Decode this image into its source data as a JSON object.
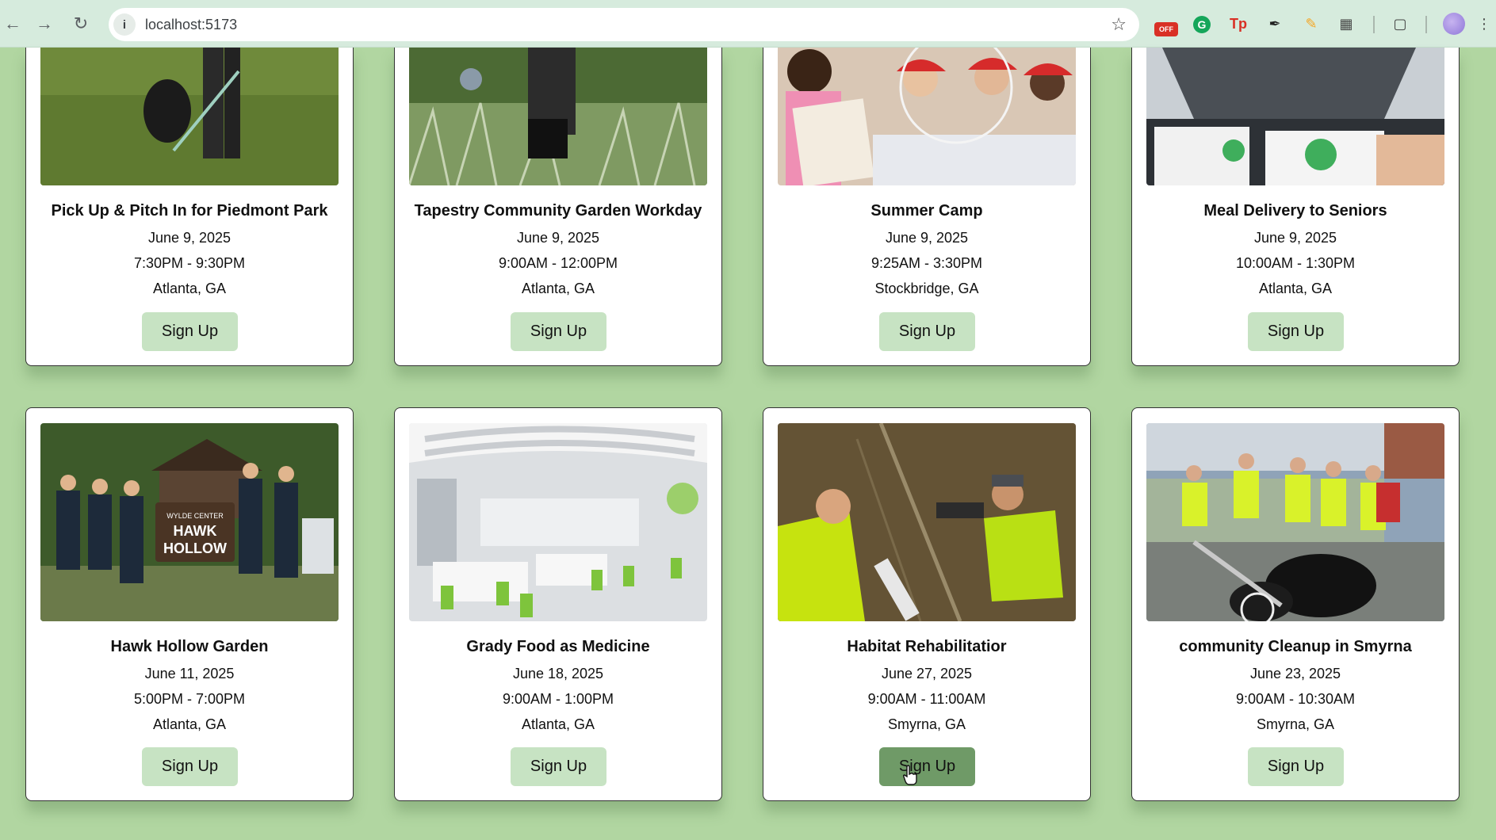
{
  "browser": {
    "url": "localhost:5173",
    "extensions": {
      "off_badge": "OFF",
      "grammarly": "G",
      "tp": "Tp"
    }
  },
  "cards": [
    {
      "title": "Pick Up & Pitch In for Piedmont Park",
      "date": "June 9, 2025",
      "time": "7:30PM - 9:30PM",
      "location": "Atlanta, GA",
      "button": "Sign Up"
    },
    {
      "title": "Tapestry Community Garden Workday",
      "date": "June 9, 2025",
      "time": "9:00AM - 12:00PM",
      "location": "Atlanta, GA",
      "button": "Sign Up"
    },
    {
      "title": "Summer Camp",
      "date": "June 9, 2025",
      "time": "9:25AM - 3:30PM",
      "location": "Stockbridge, GA",
      "button": "Sign Up"
    },
    {
      "title": "Meal Delivery to Seniors",
      "date": "June 9, 2025",
      "time": "10:00AM - 1:30PM",
      "location": "Atlanta, GA",
      "button": "Sign Up"
    },
    {
      "title": "Hawk Hollow Garden",
      "date": "June 11, 2025",
      "time": "5:00PM - 7:00PM",
      "location": "Atlanta, GA",
      "button": "Sign Up",
      "sign_text": [
        "WYLDE CENTER",
        "HAWK",
        "HOLLOW"
      ]
    },
    {
      "title": "Grady Food as Medicine",
      "date": "June 18, 2025",
      "time": "9:00AM - 1:00PM",
      "location": "Atlanta, GA",
      "button": "Sign Up"
    },
    {
      "title": "Habitat Rehabilitatior",
      "date": "June 27, 2025",
      "time": "9:00AM - 11:00AM",
      "location": "Smyrna, GA",
      "button": "Sign Up"
    },
    {
      "title": "community Cleanup in Smyrna",
      "date": "June 23, 2025",
      "time": "9:00AM - 10:30AM",
      "location": "Smyrna, GA",
      "button": "Sign Up"
    }
  ],
  "colors": {
    "page_background": "#b1d6a1",
    "button": "#c7e3c3",
    "button_active": "#6f9a67"
  }
}
